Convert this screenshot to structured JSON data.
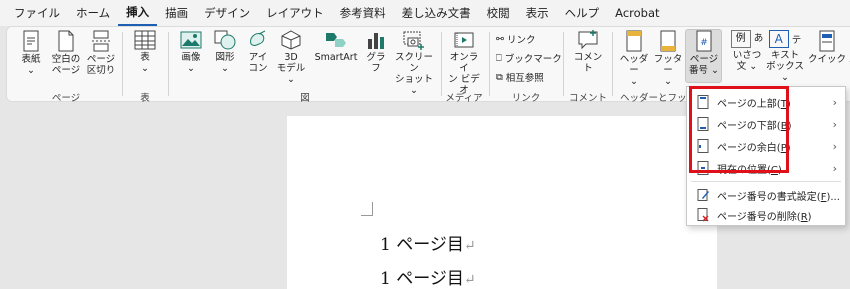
{
  "menubar": {
    "tabs": [
      "ファイル",
      "ホーム",
      "挿入",
      "描画",
      "デザイン",
      "レイアウト",
      "参考資料",
      "差し込み文書",
      "校閲",
      "表示",
      "ヘルプ",
      "Acrobat"
    ],
    "active_tab": "挿入"
  },
  "ribbon": {
    "pages_group": {
      "label": "ページ",
      "cover": "表紙",
      "cover_arrow": "⌄",
      "blank_l1": "空白の",
      "blank_l2": "ページ",
      "break_l1": "ページ",
      "break_l2": "区切り"
    },
    "table_group": {
      "label": "表",
      "table": "表",
      "table_arrow": "⌄"
    },
    "illust_group": {
      "label": "図",
      "image": "画像",
      "image_arrow": "⌄",
      "shape": "図形",
      "shape_arrow": "⌄",
      "icon_l1": "アイ",
      "icon_l2": "コン",
      "model_l1": "3D",
      "model_l2": "モデル ⌄",
      "smartart": "SmartArt",
      "chart": "グラフ",
      "screenshot_l1": "スクリーン",
      "screenshot_l2": "ショット ⌄"
    },
    "media_group": {
      "label": "メディア",
      "online_l1": "オンライ",
      "online_l2": "ン ビデオ"
    },
    "link_group": {
      "label": "リンク",
      "link": "リンク",
      "bookmark": "ブックマーク",
      "crossref": "相互参照"
    },
    "comment_group": {
      "label": "コメント",
      "comment": "コメント"
    },
    "header_group": {
      "label": "ヘッダーとフッ",
      "header": "ヘッダー",
      "header_arrow": "⌄",
      "footer": "フッター",
      "footer_arrow": "⌄",
      "pagenum_l1": "ページ",
      "pagenum_l2": "番号 ⌄"
    },
    "text_group": {
      "greeting_l1": "あいさつ",
      "greeting_l2": "文 ⌄",
      "textbox_l1": "テキスト",
      "textbox_l2": "ボックス ⌄",
      "quickparts_l1": "クイック パー",
      "preview_char": "例",
      "textbox_char": "A"
    }
  },
  "document": {
    "lines": [
      "1 ページ目",
      "1 ページ目"
    ],
    "return_mark": "↵"
  },
  "dropdown": {
    "items": [
      {
        "label": "ページの上部(",
        "key": "T",
        "tail": ")",
        "submenu": "›"
      },
      {
        "label": "ページの下部(",
        "key": "B",
        "tail": ")",
        "submenu": "›"
      },
      {
        "label": "ページの余白(",
        "key": "P",
        "tail": ")",
        "submenu": "›"
      },
      {
        "label": "現在の位置(",
        "key": "C",
        "tail": ")",
        "submenu": "›"
      },
      {
        "label": "ページ番号の書式設定(",
        "key": "F",
        "tail": ")...",
        "submenu": ""
      },
      {
        "label": "ページ番号の削除(",
        "key": "R",
        "tail": ")",
        "submenu": ""
      }
    ]
  },
  "colors": {
    "highlight_red": "#e0101a",
    "accent_blue": "#1e5fb3",
    "icon_teal": "#1d7a6a"
  }
}
